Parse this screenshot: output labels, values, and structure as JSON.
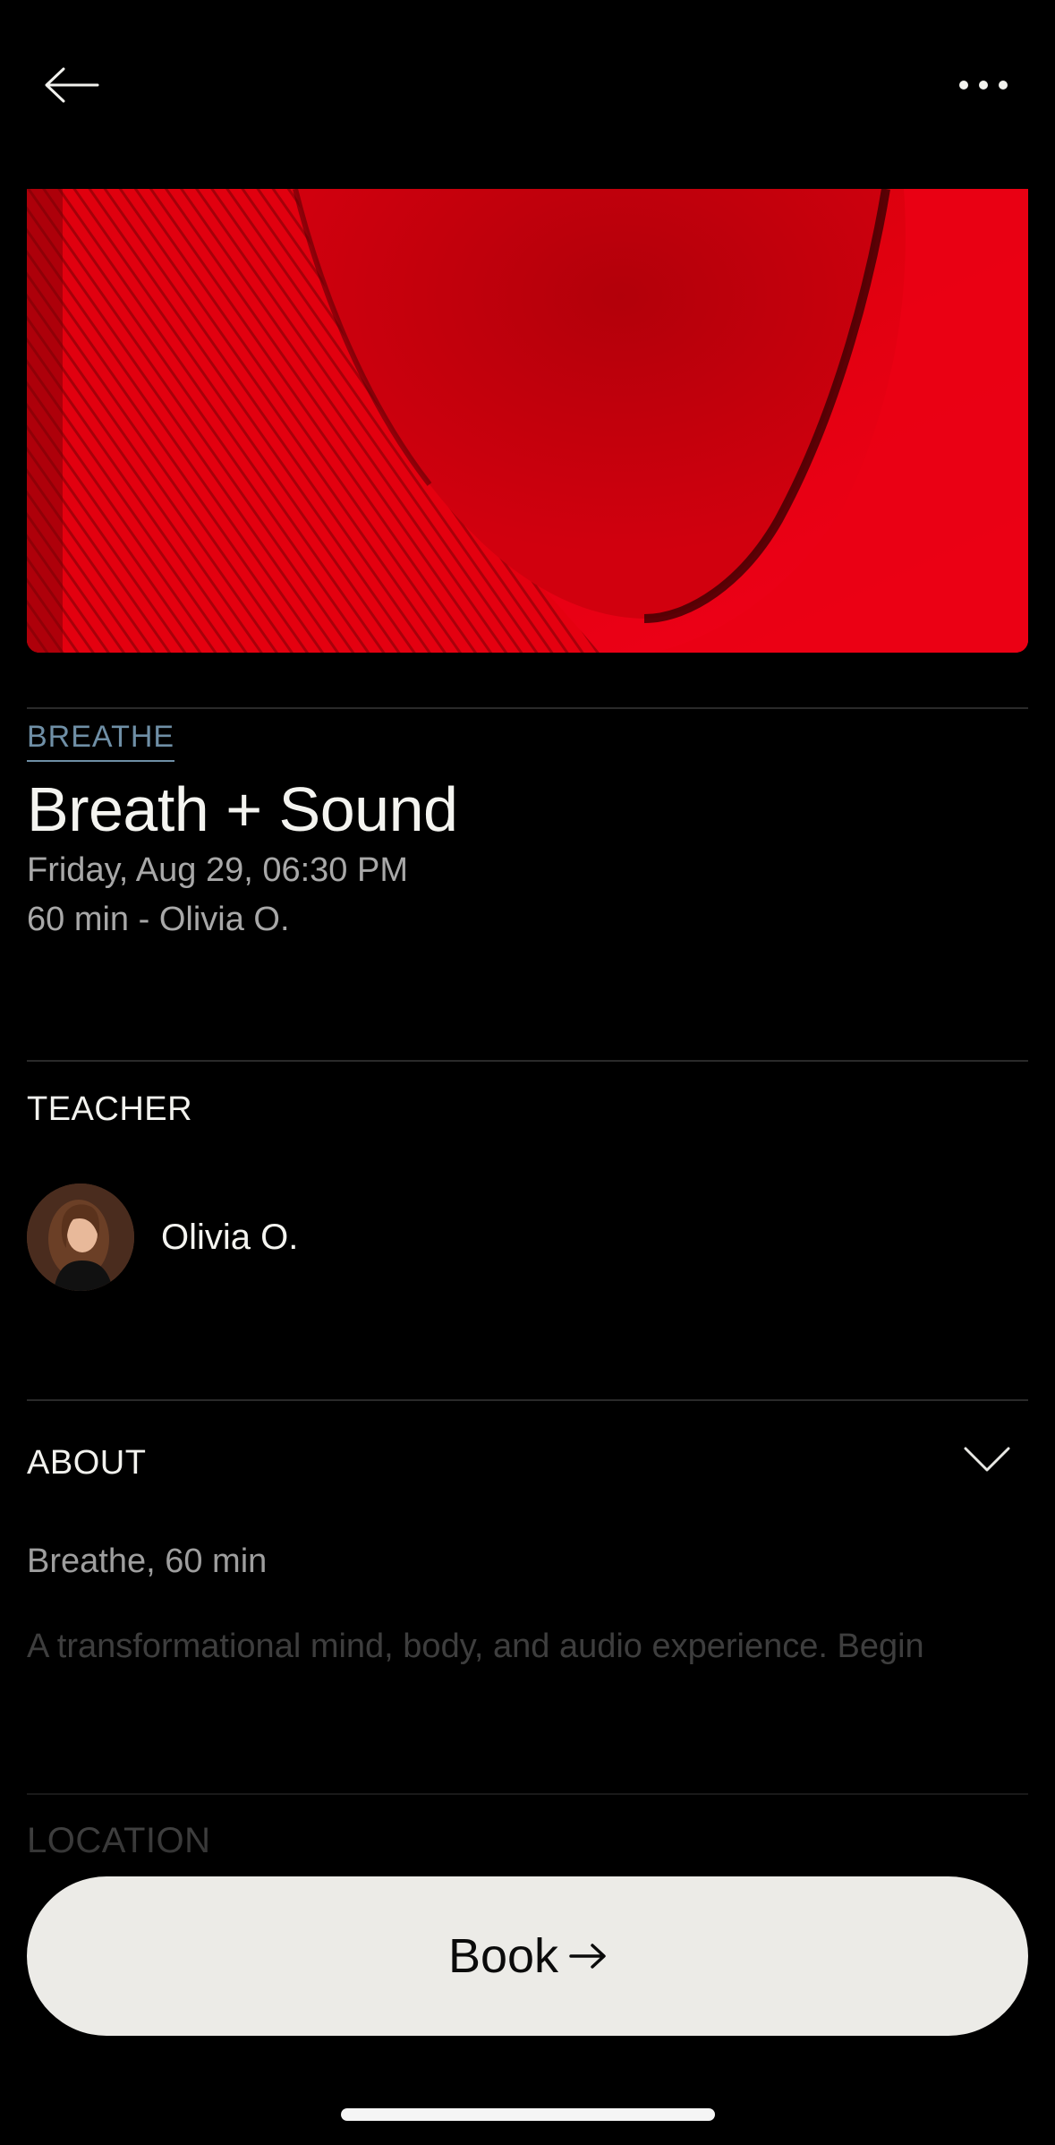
{
  "header": {
    "back_icon": "arrow-left-icon",
    "more_icon": "more-horizontal-icon"
  },
  "hero": {
    "image": "red-textured-abstract-image",
    "accent_color": "#d8000e"
  },
  "class": {
    "category": "BREATHE",
    "title": "Breath + Sound",
    "datetime": "Friday, Aug 29, 06:30 PM",
    "duration_teacher": "60 min - Olivia O."
  },
  "teacher_section": {
    "label": "TEACHER",
    "name": "Olivia O.",
    "avatar": "teacher-avatar"
  },
  "about_section": {
    "label": "ABOUT",
    "expand_icon": "chevron-down-icon",
    "subtitle": "Breathe, 60 min",
    "description": "A transformational mind, body, and audio experience. Begin"
  },
  "location_section": {
    "label": "LOCATION"
  },
  "cta": {
    "label": "Book",
    "icon": "arrow-right-icon",
    "background": "#ecebe7"
  }
}
